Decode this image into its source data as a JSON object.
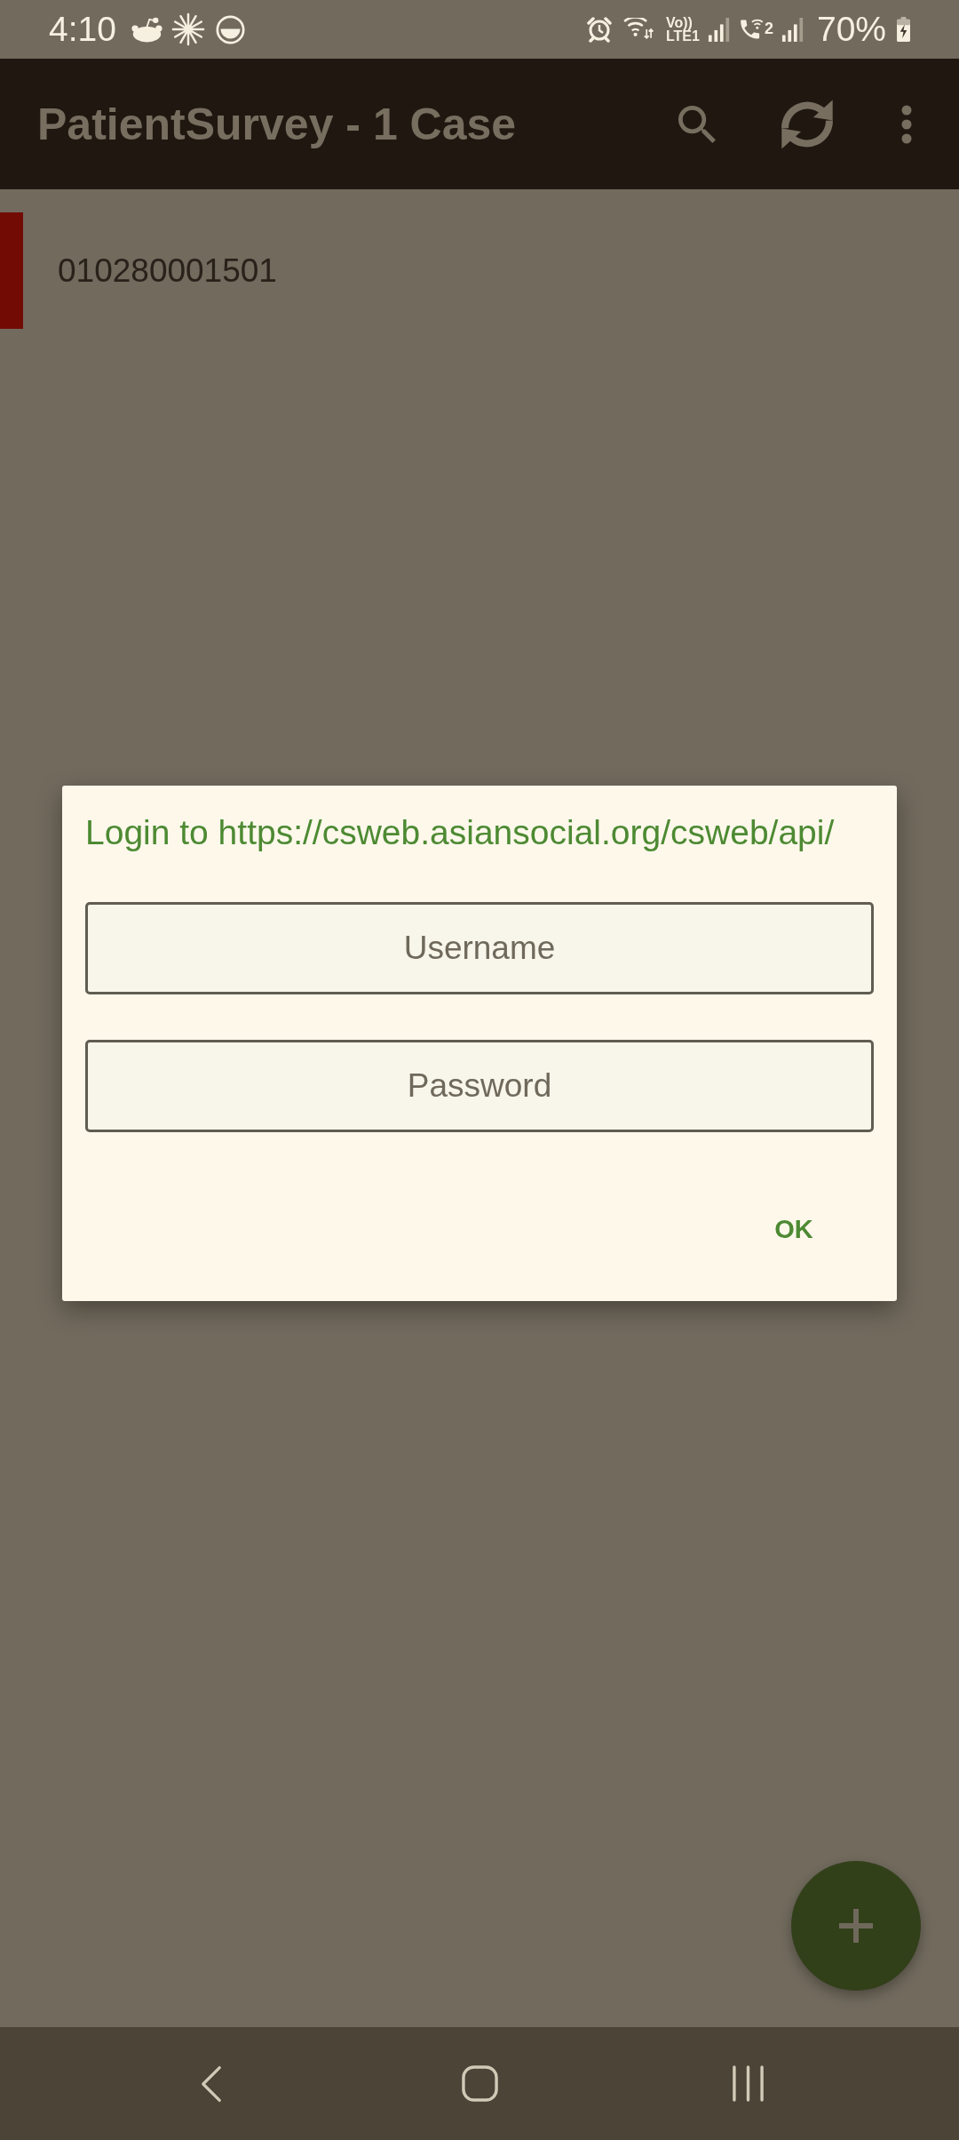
{
  "status_bar": {
    "time": "4:10",
    "volte_label": "Vo))",
    "lte_label": "LTE1",
    "sim_label": "2",
    "battery_percent": "70%"
  },
  "app_bar": {
    "title": "PatientSurvey - 1 Case"
  },
  "cases": [
    {
      "id": "010280001501",
      "color": "#730b05"
    }
  ],
  "dialog": {
    "title": "Login to https://csweb.asiansocial.org/csweb/api/",
    "fields": [
      {
        "placeholder": "Username"
      },
      {
        "placeholder": "Password"
      }
    ],
    "buttons": [
      "OK"
    ]
  }
}
